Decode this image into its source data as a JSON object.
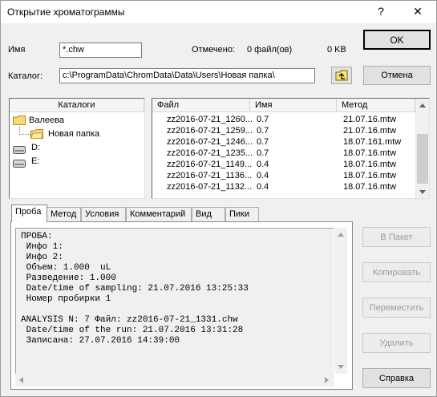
{
  "window": {
    "title": "Открытие хроматограммы"
  },
  "titlebar": {
    "help": "?",
    "close": "✕"
  },
  "name_row": {
    "label": "Имя",
    "value": "*.chw",
    "selected_label": "Отмечено:",
    "selected_count": "0 файл(ов)",
    "selected_size": "0 KB"
  },
  "catalog_row": {
    "label": "Каталог:",
    "value": "c:\\ProgramData\\ChromData\\Data\\Users\\Новая папка\\"
  },
  "buttons": {
    "ok": "OK",
    "cancel": "Отмена",
    "to_batch": "В Пакет",
    "copy": "Копировать",
    "move": "Переместить",
    "delete": "Удалить",
    "help": "Справка"
  },
  "tree": {
    "header": "Каталоги",
    "items": [
      {
        "label": "Валеева"
      },
      {
        "label": "Новая папка"
      },
      {
        "label": "D:"
      },
      {
        "label": "E:"
      }
    ]
  },
  "files": {
    "headers": {
      "file": "Файл",
      "name": "Имя",
      "method": "Метод"
    },
    "rows": [
      {
        "file": "zz2016-07-21_1260...",
        "name": "0.7",
        "method": "21.07.16.mtw"
      },
      {
        "file": "zz2016-07-21_1259...",
        "name": "0.7",
        "method": "21.07.16.mtw"
      },
      {
        "file": "zz2016-07-21_1246...",
        "name": "0.7",
        "method": "18.07.161.mtw"
      },
      {
        "file": "zz2016-07-21_1235...",
        "name": "0.7",
        "method": "18.07.16.mtw"
      },
      {
        "file": "zz2016-07-21_1149...",
        "name": "0.4",
        "method": "18.07.16.mtw"
      },
      {
        "file": "zz2016-07-21_1136...",
        "name": "0.4",
        "method": "18.07.16.mtw"
      },
      {
        "file": "zz2016-07-21_1132...",
        "name": "0.4",
        "method": "18.07.16.mtw"
      }
    ]
  },
  "tabs": [
    {
      "label": "Проба"
    },
    {
      "label": "Метод"
    },
    {
      "label": "Условия"
    },
    {
      "label": "Комментарий"
    },
    {
      "label": "Вид"
    },
    {
      "label": "Пики"
    }
  ],
  "probe_text": [
    "ПРОБА:",
    " Инфо 1:",
    " Инфо 2:",
    " Объем: 1.000  uL",
    " Разведение: 1.000",
    " Date/time of sampling: 21.07.2016 13:25:33",
    " Номер пробирки 1",
    "",
    "ANALYSIS N: 7 Файл: zz2016-07-21_1331.chw",
    " Date/time of the run: 21.07.2016 13:31:28",
    " Записана: 27.07.2016 14:39:00"
  ]
}
